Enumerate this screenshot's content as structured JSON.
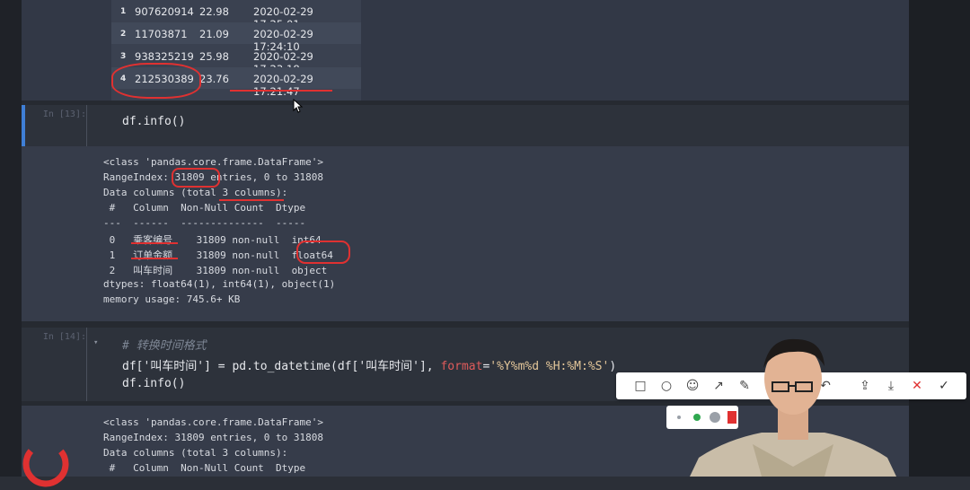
{
  "dataframe": {
    "rows": [
      {
        "idx": "1",
        "c1": "907620914",
        "c2": "22.98",
        "c3": "2020-02-29 17:25:01"
      },
      {
        "idx": "2",
        "c1": "11703871",
        "c2": "21.09",
        "c3": "2020-02-29 17:24:10"
      },
      {
        "idx": "3",
        "c1": "938325219",
        "c2": "25.98",
        "c3": "2020-02-29 17:23:18"
      },
      {
        "idx": "4",
        "c1": "212530389",
        "c2": "23.76",
        "c3": "2020-02-29 17:21:47"
      }
    ]
  },
  "cell1": {
    "prompt": "In [13]:",
    "code": "df.info()",
    "output": [
      "<class 'pandas.core.frame.DataFrame'>",
      "RangeIndex: 31809 entries, 0 to 31808",
      "Data columns (total 3 columns):",
      " #   Column  Non-Null Count  Dtype",
      "---  ------  --------------  -----",
      " 0   乘客编号    31809 non-null  int64",
      " 1   订单金额    31809 non-null  float64",
      " 2   叫车时间    31809 non-null  object",
      "dtypes: float64(1), int64(1), object(1)",
      "memory usage: 745.6+ KB"
    ]
  },
  "cell2": {
    "prompt": "In [14]:",
    "comment": "# 转换时间格式",
    "code_part1": "df['叫车时间'] = pd.to_datetime(df['叫车时间'], ",
    "code_kw": "format",
    "code_part2": "=",
    "code_str": "'%Y%m%d %H:%M:%S'",
    "code_part3": ")",
    "code_line2": "df.info()",
    "output": [
      "<class 'pandas.core.frame.DataFrame'>",
      "RangeIndex: 31809 entries, 0 to 31808",
      "Data columns (total 3 columns):",
      " #   Column  Non-Null Count  Dtype"
    ]
  },
  "toolbar": {
    "icons": [
      "square-icon",
      "circle-icon",
      "emoji-icon",
      "arrow-icon",
      "pen-icon",
      "text-icon",
      "mosaic-icon",
      "undo-icon",
      "share-icon",
      "download-icon",
      "close-icon",
      "check-icon"
    ],
    "glyphs": [
      "□",
      "○",
      "☺",
      "↗",
      "✎",
      "T",
      "▦",
      "↶",
      "⇪",
      "⤓",
      "✕",
      "✓"
    ]
  },
  "colors": {
    "annotation": "#e03131",
    "selection": "#3f7fd6"
  }
}
